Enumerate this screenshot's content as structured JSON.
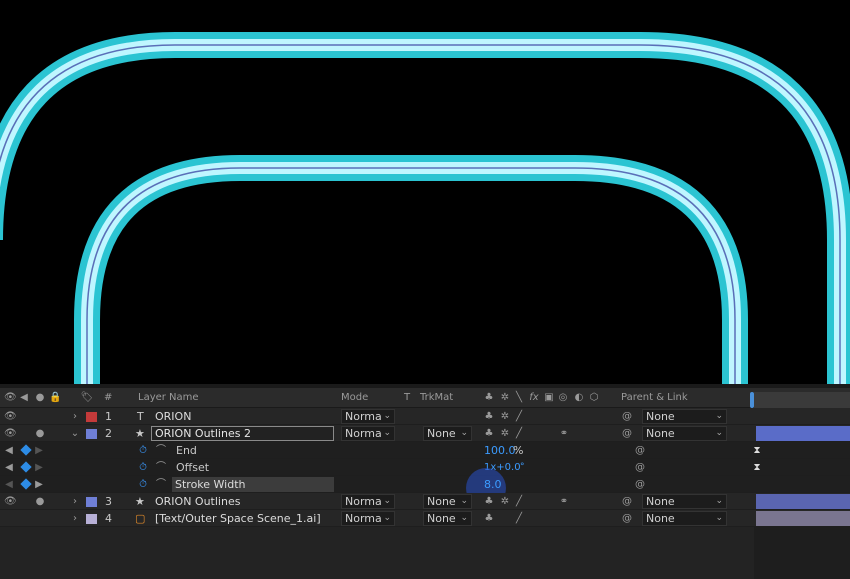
{
  "colors": {
    "neon_outer": "#2bc4d2",
    "neon_inner": "#bff6ff",
    "neon_core": "#5a6fb8",
    "label_red": "#c43a3a",
    "label_blue": "#6f7fd6",
    "label_lilac": "#b7b0d6",
    "accent_blue": "#3b9bff"
  },
  "header": {
    "layer_name": "Layer Name",
    "number": "#",
    "mode": "Mode",
    "t": "T",
    "trkmat": "TrkMat",
    "parent_link": "Parent & Link"
  },
  "layers": [
    {
      "num": "1",
      "type_icon": "T",
      "name": "ORION",
      "mode": "Norma",
      "trkmat": "",
      "parent": "None",
      "label_color": "#c43a3a"
    },
    {
      "num": "2",
      "type_icon": "★",
      "name": "ORION Outlines 2",
      "mode": "Norma",
      "trkmat": "None",
      "parent": "None",
      "label_color": "#6f7fd6"
    },
    {
      "num": "3",
      "type_icon": "★",
      "name": "ORION Outlines",
      "mode": "Norma",
      "trkmat": "None",
      "parent": "None",
      "label_color": "#6f7fd6"
    },
    {
      "num": "4",
      "type_icon": "▢",
      "name": "[Text/Outer Space Scene_1.ai]",
      "mode": "Norma",
      "trkmat": "None",
      "parent": "None",
      "label_color": "#b7b0d6"
    }
  ],
  "properties": [
    {
      "name": "End",
      "value": "100.0",
      "unit": "%"
    },
    {
      "name": "Offset",
      "value": "1x+0.0",
      "unit": "°"
    },
    {
      "name": "Stroke Width",
      "value": "8.0",
      "unit": ""
    }
  ]
}
